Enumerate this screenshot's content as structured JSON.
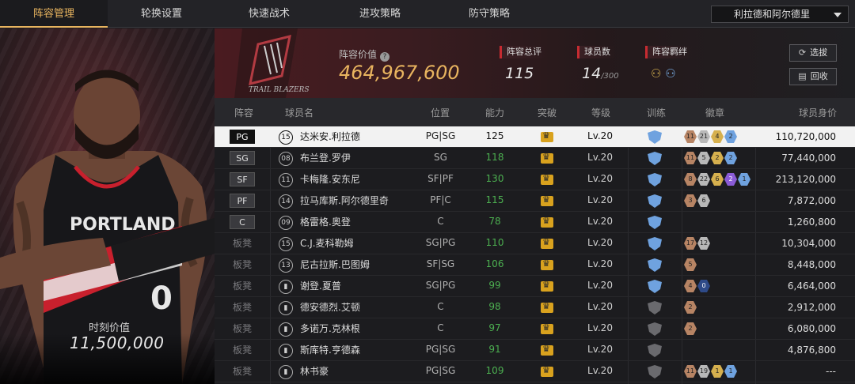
{
  "nav": {
    "tabs": [
      "阵容管理",
      "轮换设置",
      "快速战术",
      "进攻策略",
      "防守策略"
    ],
    "active_tab": "阵容管理",
    "team_selector": "利拉德和阿尔德里"
  },
  "featured": {
    "value_label": "时刻价值",
    "value": "11,500,000",
    "jersey_text": "PORTLAND",
    "jersey_number": "0"
  },
  "summary": {
    "logo_text": "TRAIL BLAZERS",
    "lineup_value_label": "阵容价值",
    "lineup_value": "464,967,600",
    "overall_label": "阵容总评",
    "overall": "115",
    "roster_label": "球员数",
    "roster_count": "14",
    "roster_max": "/300",
    "bond_label": "阵容羁绊",
    "buttons": {
      "select": "选拔",
      "recycle": "回收"
    }
  },
  "table": {
    "headers": [
      "阵容",
      "球员名",
      "位置",
      "能力",
      "突破",
      "等级",
      "训练",
      "徽章",
      "球员身价"
    ],
    "rows": [
      {
        "slot": "PG",
        "num": "15",
        "name": "达米安.利拉德",
        "pos": "PG|SG",
        "ovr": "125",
        "ovr_color": "#ffffff",
        "lvl": "Lv.20",
        "train": "blue",
        "badges": [
          [
            "br",
            "11"
          ],
          [
            "si",
            "21"
          ],
          [
            "go",
            "4"
          ],
          [
            "bl",
            "2"
          ]
        ],
        "price": "110,720,000",
        "selected": true
      },
      {
        "slot": "SG",
        "num": "08",
        "name": "布兰登.罗伊",
        "pos": "SG",
        "ovr": "118",
        "ovr_color": "#4caf50",
        "lvl": "Lv.20",
        "train": "blue",
        "badges": [
          [
            "br",
            "11"
          ],
          [
            "si",
            "5"
          ],
          [
            "go",
            "2"
          ],
          [
            "bl",
            "2"
          ]
        ],
        "price": "77,440,000"
      },
      {
        "slot": "SF",
        "num": "11",
        "name": "卡梅隆.安东尼",
        "pos": "SF|PF",
        "ovr": "130",
        "ovr_color": "#4caf50",
        "lvl": "Lv.20",
        "train": "blue",
        "badges": [
          [
            "br",
            "8"
          ],
          [
            "si",
            "22"
          ],
          [
            "go",
            "6"
          ],
          [
            "pu",
            "2"
          ],
          [
            "bl",
            "1"
          ]
        ],
        "price": "213,120,000"
      },
      {
        "slot": "PF",
        "num": "14",
        "name": "拉马库斯.阿尔德里奇",
        "pos": "PF|C",
        "ovr": "115",
        "ovr_color": "#4caf50",
        "lvl": "Lv.20",
        "train": "blue",
        "badges": [
          [
            "br",
            "3"
          ],
          [
            "si",
            "6"
          ]
        ],
        "price": "7,872,000"
      },
      {
        "slot": "C",
        "num": "09",
        "name": "格雷格.奥登",
        "pos": "C",
        "ovr": "78",
        "ovr_color": "#4caf50",
        "lvl": "Lv.20",
        "train": "blue",
        "badges": [],
        "price": "1,260,800"
      },
      {
        "slot": "板凳",
        "num": "15",
        "name": "C.J.麦科勒姆",
        "pos": "SG|PG",
        "ovr": "110",
        "ovr_color": "#4caf50",
        "lvl": "Lv.20",
        "train": "blue",
        "badges": [
          [
            "br",
            "17"
          ],
          [
            "si",
            "12"
          ]
        ],
        "price": "10,304,000"
      },
      {
        "slot": "板凳",
        "num": "13",
        "name": "尼古拉斯.巴图姆",
        "pos": "SF|SG",
        "ovr": "106",
        "ovr_color": "#4caf50",
        "lvl": "Lv.20",
        "train": "blue",
        "badges": [
          [
            "br",
            "5"
          ]
        ],
        "price": "8,448,000"
      },
      {
        "slot": "板凳",
        "num": "",
        "name": "谢登.夏普",
        "pos": "SG|PG",
        "ovr": "99",
        "ovr_color": "#4caf50",
        "lvl": "Lv.20",
        "train": "blue1",
        "badges": [
          [
            "br",
            "4"
          ],
          [
            "db",
            "0"
          ]
        ],
        "price": "6,464,000"
      },
      {
        "slot": "板凳",
        "num": "",
        "name": "德安德烈.艾顿",
        "pos": "C",
        "ovr": "98",
        "ovr_color": "#4caf50",
        "lvl": "Lv.20",
        "train": "gray",
        "badges": [
          [
            "br",
            "2"
          ]
        ],
        "price": "2,912,000"
      },
      {
        "slot": "板凳",
        "num": "",
        "name": "多诺万.克林根",
        "pos": "C",
        "ovr": "97",
        "ovr_color": "#4caf50",
        "lvl": "Lv.20",
        "train": "gray",
        "badges": [
          [
            "br",
            "2"
          ]
        ],
        "price": "6,080,000"
      },
      {
        "slot": "板凳",
        "num": "",
        "name": "斯库特.亨德森",
        "pos": "PG|SG",
        "ovr": "91",
        "ovr_color": "#4caf50",
        "lvl": "Lv.20",
        "train": "gray",
        "badges": [],
        "price": "4,876,800"
      },
      {
        "slot": "板凳",
        "num": "",
        "name": "林书豪",
        "pos": "PG|SG",
        "ovr": "109",
        "ovr_color": "#4caf50",
        "lvl": "Lv.20",
        "train": "gray",
        "badges": [
          [
            "br",
            "11"
          ],
          [
            "si",
            "19"
          ],
          [
            "go",
            "1"
          ],
          [
            "bl",
            "1"
          ]
        ],
        "price": "---"
      }
    ]
  }
}
